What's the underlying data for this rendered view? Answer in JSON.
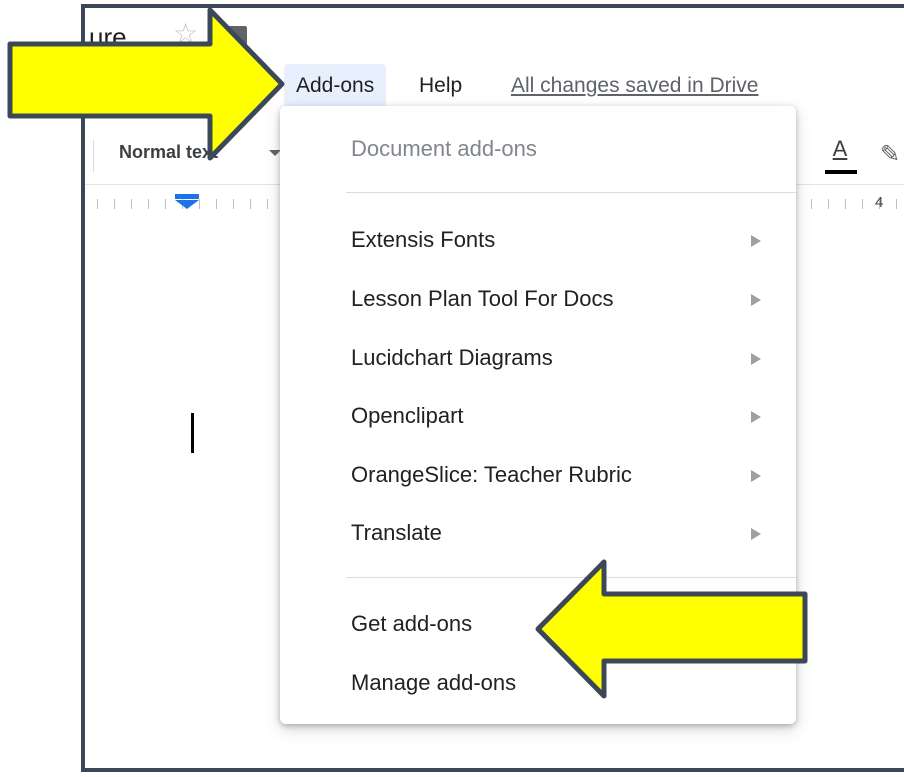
{
  "document": {
    "title_fragment": "ure",
    "star_glyph": "☆"
  },
  "menubar": {
    "addons": "Add-ons",
    "help": "Help",
    "saved_status": "All changes saved in Drive"
  },
  "toolbar": {
    "style_value": "Normal text",
    "text_color_letter": "A",
    "highlight_glyph": "✎"
  },
  "ruler": {
    "number": "4"
  },
  "addons_menu": {
    "header": "Document add-ons",
    "items": [
      {
        "label": "Extensis Fonts"
      },
      {
        "label": "Lesson Plan Tool For Docs"
      },
      {
        "label": "Lucidchart Diagrams"
      },
      {
        "label": "Openclipart"
      },
      {
        "label": "OrangeSlice: Teacher Rubric"
      },
      {
        "label": "Translate"
      }
    ],
    "get_addons": "Get add-ons",
    "manage_addons": "Manage add-ons"
  },
  "colors": {
    "annotation_arrow_fill": "#ffff00",
    "annotation_arrow_stroke": "#3c4858",
    "active_menu_bg": "#e8f0fe",
    "accent_blue": "#1a73e8"
  }
}
